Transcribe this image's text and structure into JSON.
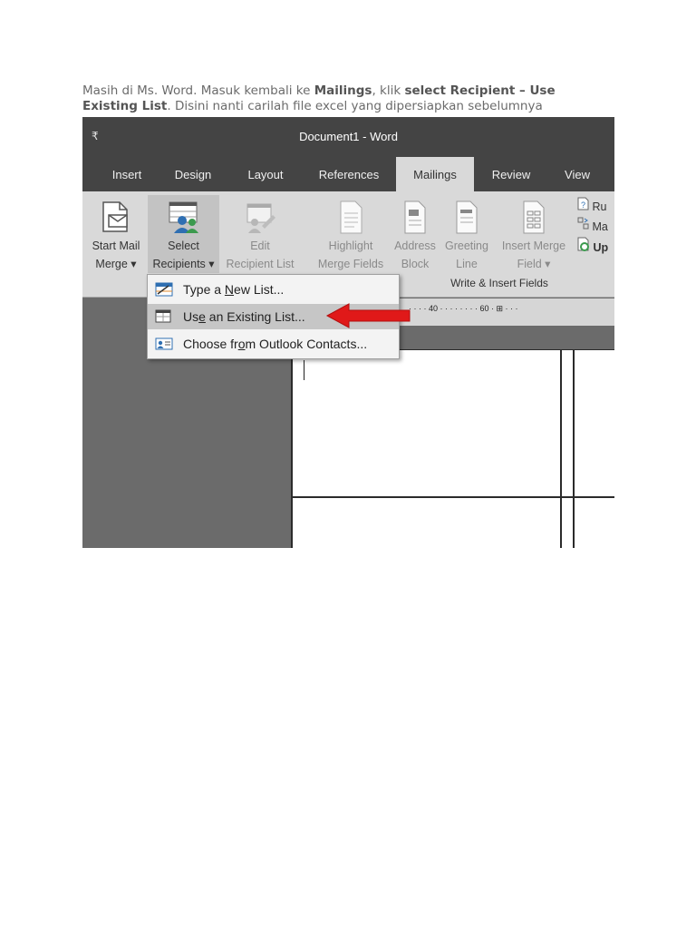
{
  "instruction": {
    "t1": "Masih di Ms. Word. Masuk kembali ke ",
    "b1": "Mailings",
    "t2": ", klik ",
    "b2": "select Recipient – Use Existing List",
    "t3": ". Disini nanti carilah file excel yang dipersiapkan sebelumnya"
  },
  "word": {
    "qat_symbol": "₹",
    "title": "Document1  -  Word",
    "tabs": [
      "Insert",
      "Design",
      "Layout",
      "References",
      "Mailings",
      "Review",
      "View"
    ],
    "ribbon": {
      "start_mail_merge": [
        "Start Mail",
        "Merge ▾"
      ],
      "select_recipients": [
        "Select",
        "Recipients ▾"
      ],
      "edit_recipient_list": [
        "Edit",
        "Recipient List"
      ],
      "highlight_merge_fields": [
        "Highlight",
        "Merge Fields"
      ],
      "address_block": [
        "Address",
        "Block"
      ],
      "greeting_line": [
        "Greeting",
        "Line"
      ],
      "insert_merge_field": [
        "Insert Merge",
        "Field ▾"
      ],
      "group_write_insert": "Write & Insert Fields",
      "rules": "Ru",
      "match_fields": "Ma",
      "update_labels": "Up"
    },
    "ruler_text": "· · · · 40 · · · · · · · · 60 ·  ⊞ ·  · ·",
    "menu": {
      "type_new_list": {
        "pre": "Type a ",
        "ul": "N",
        "post": "ew List..."
      },
      "use_existing_list": {
        "pre": "Us",
        "ul": "e",
        "post": " an Existing List..."
      },
      "choose_outlook": {
        "pre": "Choose fr",
        "ul": "o",
        "post": "m Outlook Contacts..."
      }
    }
  },
  "colors": {
    "arrow": "#e01919",
    "dark_bar": "#444444",
    "ribbon_bg": "#d9d9d9"
  }
}
